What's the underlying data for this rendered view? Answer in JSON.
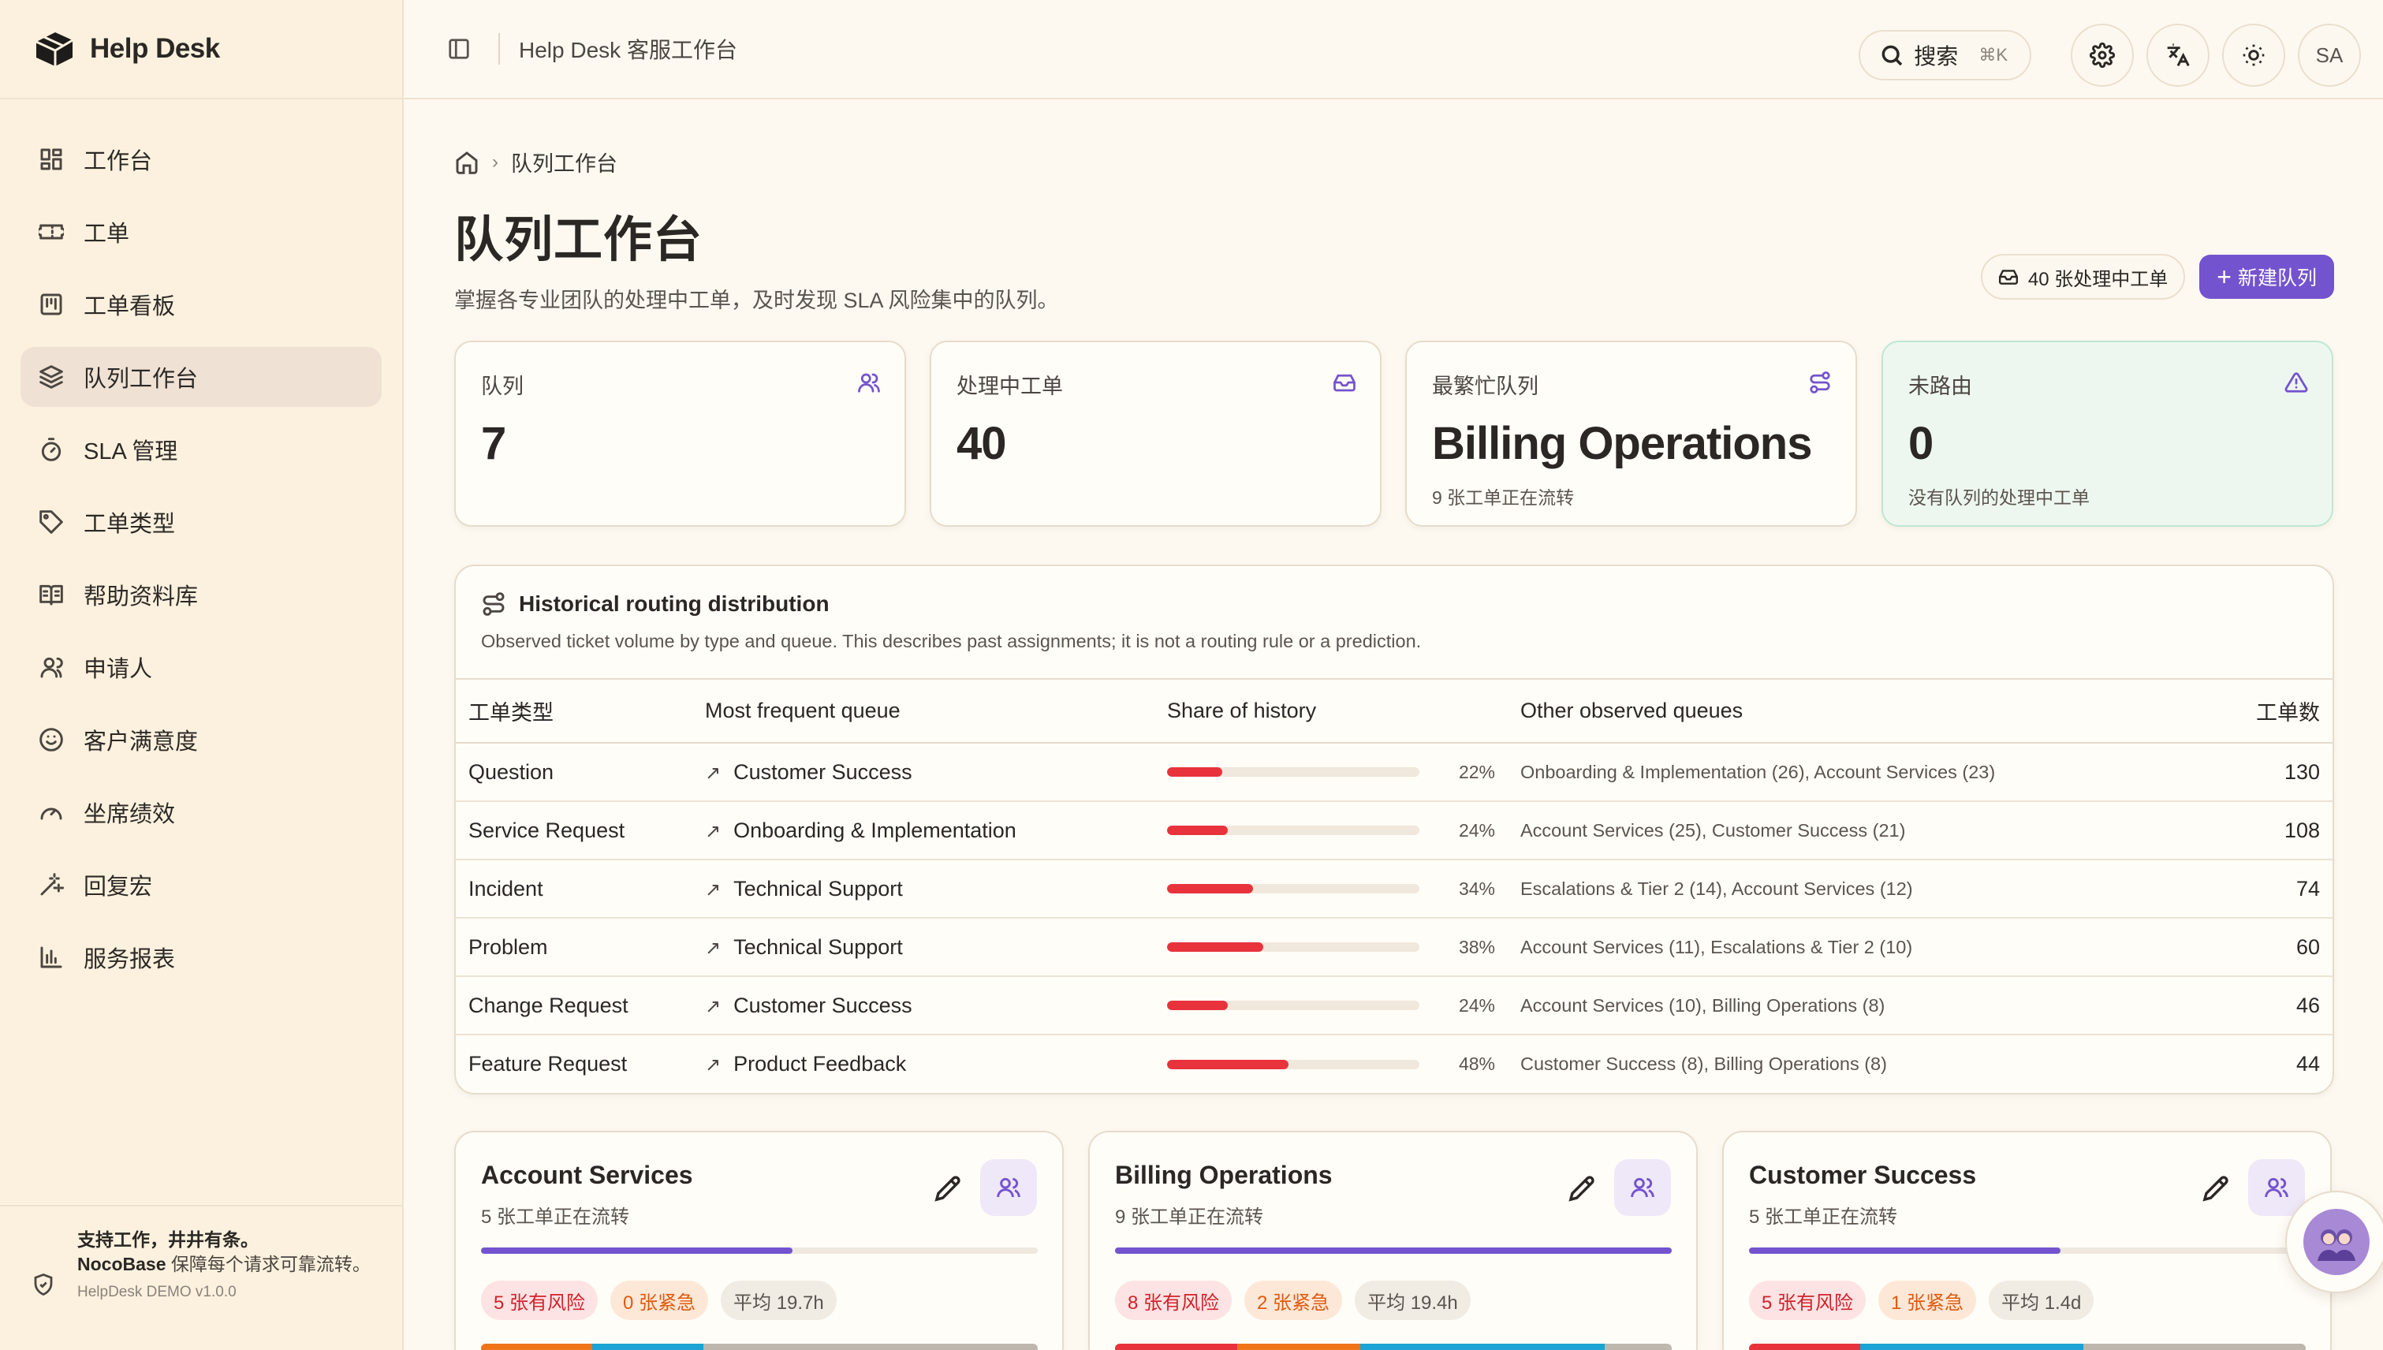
{
  "brand": {
    "name": "Help Desk"
  },
  "sidebar": {
    "items": [
      {
        "label": "工作台",
        "icon": "dashboard-icon"
      },
      {
        "label": "工单",
        "icon": "ticket-icon"
      },
      {
        "label": "工单看板",
        "icon": "kanban-icon"
      },
      {
        "label": "队列工作台",
        "icon": "layers-icon",
        "active": true
      },
      {
        "label": "SLA 管理",
        "icon": "timer-icon"
      },
      {
        "label": "工单类型",
        "icon": "tag-icon"
      },
      {
        "label": "帮助资料库",
        "icon": "book-icon"
      },
      {
        "label": "申请人",
        "icon": "user-icon"
      },
      {
        "label": "客户满意度",
        "icon": "smile-icon"
      },
      {
        "label": "坐席绩效",
        "icon": "gauge-icon"
      },
      {
        "label": "回复宏",
        "icon": "wand-icon"
      },
      {
        "label": "服务报表",
        "icon": "bar-chart-icon"
      }
    ],
    "footer": {
      "title": "支持工作，井井有条。",
      "brand": "NocoBase",
      "text": " 保障每个请求可靠流转。",
      "version": "HelpDesk DEMO v1.0.0"
    }
  },
  "topbar": {
    "title": "Help Desk 客服工作台",
    "search_label": "搜索",
    "search_shortcut": "⌘K",
    "avatar_initials": "SA"
  },
  "breadcrumb": {
    "current": "队列工作台"
  },
  "page": {
    "title": "队列工作台",
    "subtitle": "掌握各专业团队的处理中工单，及时发现 SLA 风险集中的队列。",
    "count_pill": "40 张处理中工单",
    "new_button": "新建队列"
  },
  "stats": [
    {
      "label": "队列",
      "value": "7",
      "note": "",
      "icon": "users-icon"
    },
    {
      "label": "处理中工单",
      "value": "40",
      "note": "",
      "icon": "inbox-icon"
    },
    {
      "label": "最繁忙队列",
      "value": "Billing Operations",
      "note": "9 张工单正在流转",
      "icon": "route-icon"
    },
    {
      "label": "未路由",
      "value": "0",
      "note": "没有队列的处理中工单",
      "icon": "warning-icon"
    }
  ],
  "routing": {
    "title": "Historical routing distribution",
    "description": "Observed ticket volume by type and queue. This describes past assignments; it is not a routing rule or a prediction.",
    "columns": [
      "工单类型",
      "Most frequent queue",
      "Share of history",
      "Other observed queues",
      "工单数"
    ],
    "rows": [
      {
        "type": "Question",
        "queue": "Customer Success",
        "share": 22,
        "share_label": "22%",
        "others": "Onboarding & Implementation (26), Account Services (23)",
        "count": "130"
      },
      {
        "type": "Service Request",
        "queue": "Onboarding & Implementation",
        "share": 24,
        "share_label": "24%",
        "others": "Account Services (25), Customer Success (21)",
        "count": "108"
      },
      {
        "type": "Incident",
        "queue": "Technical Support",
        "share": 34,
        "share_label": "34%",
        "others": "Escalations & Tier 2 (14), Account Services (12)",
        "count": "74"
      },
      {
        "type": "Problem",
        "queue": "Technical Support",
        "share": 38,
        "share_label": "38%",
        "others": "Account Services (11), Escalations & Tier 2 (10)",
        "count": "60"
      },
      {
        "type": "Change Request",
        "queue": "Customer Success",
        "share": 24,
        "share_label": "24%",
        "others": "Account Services (10), Billing Operations (8)",
        "count": "46"
      },
      {
        "type": "Feature Request",
        "queue": "Product Feedback",
        "share": 48,
        "share_label": "48%",
        "others": "Customer Success (8), Billing Operations (8)",
        "count": "44"
      }
    ]
  },
  "queues": [
    {
      "name": "Account Services",
      "note": "5 张工单正在流转",
      "load": 0.56,
      "badges": [
        "5 张有风险",
        "0 张紧急",
        "平均 19.7h"
      ],
      "stack": [
        {
          "share": 0.2,
          "color": "#f0741a"
        },
        {
          "share": 0.2,
          "color": "#1aa3d4"
        },
        {
          "share": 0.6,
          "color": "#bdb7ae"
        }
      ]
    },
    {
      "name": "Billing Operations",
      "note": "9 张工单正在流转",
      "load": 1.0,
      "badges": [
        "8 张有风险",
        "2 张紧急",
        "平均 19.4h"
      ],
      "stack": [
        {
          "share": 0.22,
          "color": "#e8333d"
        },
        {
          "share": 0.22,
          "color": "#f0741a"
        },
        {
          "share": 0.44,
          "color": "#1aa3d4"
        },
        {
          "share": 0.12,
          "color": "#bdb7ae"
        }
      ]
    },
    {
      "name": "Customer Success",
      "note": "5 张工单正在流转",
      "load": 0.56,
      "badges": [
        "5 张有风险",
        "1 张紧急",
        "平均 1.4d"
      ],
      "stack": [
        {
          "share": 0.2,
          "color": "#e8333d"
        },
        {
          "share": 0.4,
          "color": "#1aa3d4"
        },
        {
          "share": 0.4,
          "color": "#bdb7ae"
        }
      ]
    }
  ],
  "colors": {
    "accent": "#7453cf",
    "risk": "#e8333d",
    "urgent": "#e05a0f"
  }
}
